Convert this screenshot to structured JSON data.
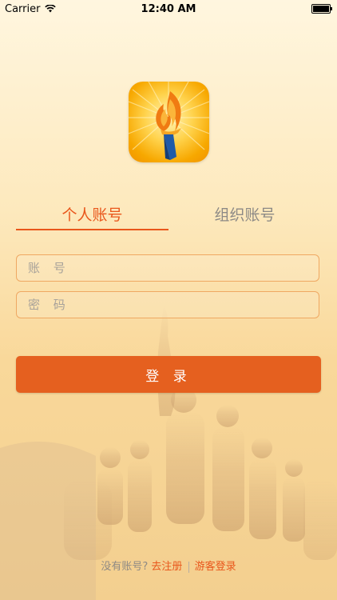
{
  "status_bar": {
    "carrier": "Carrier",
    "time": "12:40 AM"
  },
  "tabs": [
    {
      "label": "个人账号",
      "active": true
    },
    {
      "label": "组织账号",
      "active": false
    }
  ],
  "form": {
    "account_placeholder": "账 号",
    "password_placeholder": "密 码",
    "login_label": "登 录"
  },
  "footer": {
    "prompt": "没有账号?",
    "register": "去注册",
    "guest": "游客登录"
  },
  "colors": {
    "accent": "#e9571c",
    "button": "#e5601f",
    "inactive_tab": "#8d8a86"
  }
}
